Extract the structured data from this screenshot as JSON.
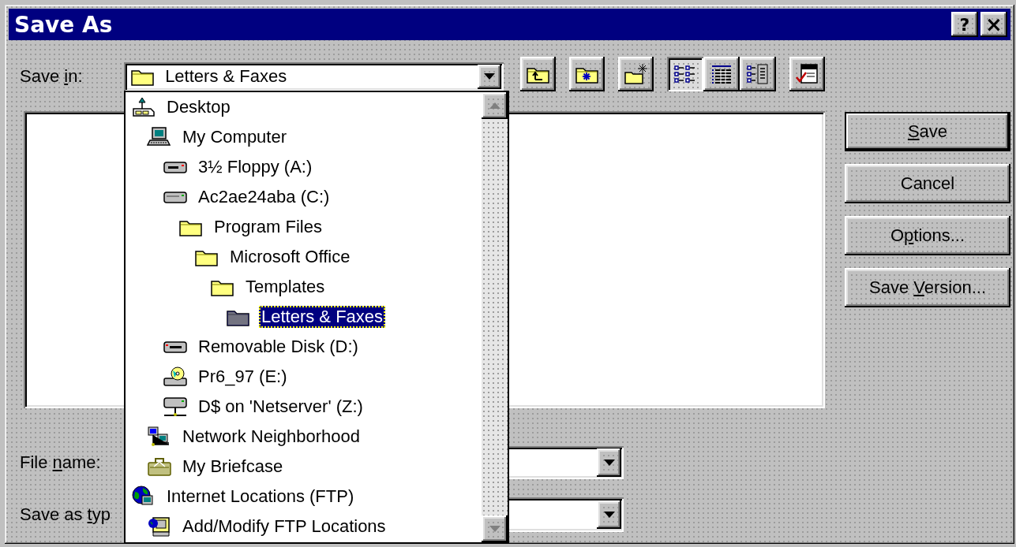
{
  "window": {
    "title": "Save As",
    "title_buttons": [
      {
        "kind": "help",
        "label": "?"
      },
      {
        "kind": "close",
        "label": "×"
      }
    ]
  },
  "save_in": {
    "label": [
      {
        "text": "Save ",
        "underlined": false
      },
      {
        "text": "i",
        "underlined": true
      },
      {
        "text": "n:",
        "underlined": false
      }
    ],
    "value": "Letters & Faxes",
    "expanded": true
  },
  "toolbar": [
    {
      "kind": "up-folder",
      "pressed": false
    },
    {
      "kind": "new-folder",
      "pressed": false
    },
    {
      "kind": "web-folder",
      "pressed": false
    },
    {
      "kind": "list",
      "pressed": true
    },
    {
      "kind": "details",
      "pressed": false
    },
    {
      "kind": "preview",
      "pressed": false
    },
    {
      "kind": "commands",
      "pressed": false
    }
  ],
  "buttons": [
    {
      "label": [
        {
          "text": "S",
          "underlined": true
        },
        {
          "text": "ave",
          "underlined": false
        }
      ],
      "default": true
    },
    {
      "label": [
        {
          "text": "Cancel",
          "underlined": false
        }
      ],
      "default": false
    },
    {
      "label": [
        {
          "text": "O",
          "underlined": false
        },
        {
          "text": "p",
          "underlined": true
        },
        {
          "text": "tions...",
          "underlined": false
        }
      ],
      "default": false
    },
    {
      "label": [
        {
          "text": "Save ",
          "underlined": false
        },
        {
          "text": "V",
          "underlined": true
        },
        {
          "text": "ersion...",
          "underlined": false
        }
      ],
      "default": false
    }
  ],
  "file_name": {
    "label": [
      {
        "text": "File ",
        "underlined": false
      },
      {
        "text": "n",
        "underlined": true
      },
      {
        "text": "ame:",
        "underlined": false
      }
    ]
  },
  "save_as_type": {
    "label": [
      {
        "text": "Save as ",
        "underlined": false
      },
      {
        "text": "t",
        "underlined": true
      },
      {
        "text": "yp",
        "underlined": false
      }
    ]
  },
  "location_list": {
    "items": [
      {
        "label": "Desktop",
        "kind": "desktop",
        "selected": false,
        "children": [
          {
            "label": "My Computer",
            "kind": "computer",
            "selected": false,
            "children": [
              {
                "label": "3½ Floppy (A:)",
                "kind": "floppy",
                "selected": false
              },
              {
                "label": "Ac2ae24aba (C:)",
                "kind": "harddisk",
                "selected": false,
                "children": [
                  {
                    "label": "Program Files",
                    "kind": "folder",
                    "selected": false,
                    "children": [
                      {
                        "label": "Microsoft Office",
                        "kind": "folder",
                        "selected": false,
                        "children": [
                          {
                            "label": "Templates",
                            "kind": "folder",
                            "selected": false,
                            "children": [
                              {
                                "label": "Letters & Faxes",
                                "kind": "folder",
                                "selected": true
                              }
                            ]
                          }
                        ]
                      }
                    ]
                  }
                ]
              },
              {
                "label": "Removable Disk (D:)",
                "kind": "removable",
                "selected": false
              },
              {
                "label": "Pr6_97 (E:)",
                "kind": "cdrom",
                "selected": false
              },
              {
                "label": "D$ on 'Netserver' (Z:)",
                "kind": "netdrive",
                "selected": false
              }
            ]
          },
          {
            "label": "Network Neighborhood",
            "kind": "network",
            "selected": false
          },
          {
            "label": "My Briefcase",
            "kind": "briefcase",
            "selected": false
          }
        ]
      },
      {
        "label": "Internet Locations (FTP)",
        "kind": "internet",
        "selected": false,
        "children": [
          {
            "label": "Add/Modify FTP Locations",
            "kind": "ftp",
            "selected": false
          }
        ]
      }
    ]
  }
}
